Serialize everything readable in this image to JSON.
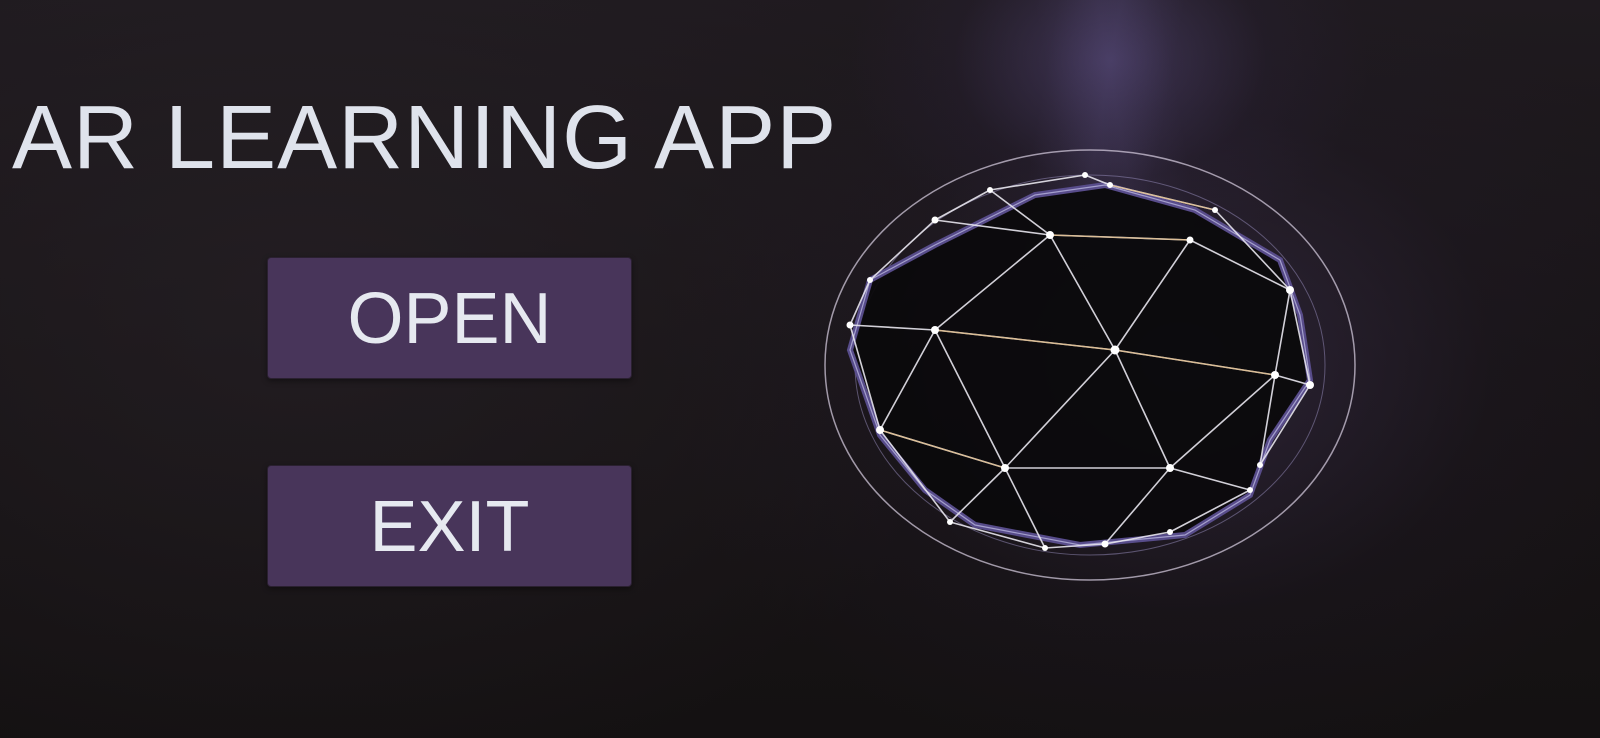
{
  "app": {
    "title": "AR LEARNING APP"
  },
  "menu": {
    "open_label": "OPEN",
    "exit_label": "EXIT"
  },
  "theme": {
    "background": "#151213",
    "button_color": "#48355a",
    "text_color": "#dfe3ec",
    "accent_glow": "#7a6ab8"
  },
  "decoration": {
    "hologram_icon": "wireframe-polyhedron-icon"
  }
}
